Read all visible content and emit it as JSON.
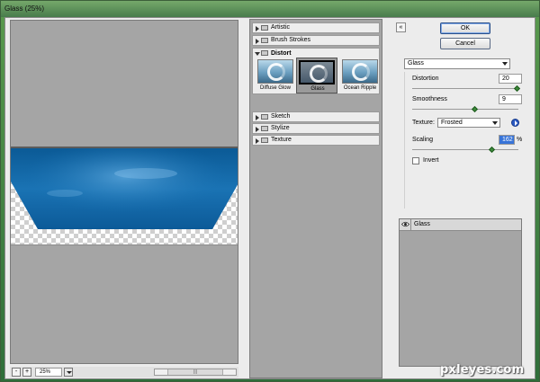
{
  "window": {
    "title": "Glass (25%)"
  },
  "colors": {
    "accent_blue": "#0d5c98",
    "canvas_gray": "#a5a5a5",
    "selected_value": "#3874d8"
  },
  "preview": {
    "zoom_minus": "-",
    "zoom_plus": "+",
    "zoom_value": "25%",
    "scroll_thumb_grip": "|||"
  },
  "gallery": {
    "folders_top": [
      {
        "label": "Artistic"
      },
      {
        "label": "Brush Strokes"
      }
    ],
    "open_folder": {
      "label": "Distort",
      "thumbnails": [
        {
          "label": "Diffuse Glow"
        },
        {
          "label": "Glass",
          "selected": true
        },
        {
          "label": "Ocean Ripple"
        }
      ]
    },
    "folders_bottom": [
      {
        "label": "Sketch"
      },
      {
        "label": "Stylize"
      },
      {
        "label": "Texture"
      }
    ]
  },
  "controls": {
    "collapse_glyph": "«",
    "ok_label": "OK",
    "cancel_label": "Cancel",
    "filter_selected": "Glass",
    "distortion": {
      "label": "Distortion",
      "value": "20",
      "fraction": 1.0
    },
    "smoothness": {
      "label": "Smoothness",
      "value": "9",
      "fraction": 0.6
    },
    "texture": {
      "label": "Texture:",
      "selected": "Frosted"
    },
    "scaling": {
      "label": "Scaling",
      "value": "162",
      "unit": "%",
      "fraction": 0.76
    },
    "invert": {
      "label": "Invert",
      "checked": false
    }
  },
  "layers": {
    "items": [
      {
        "name": "Glass",
        "visible": true
      }
    ]
  },
  "watermark": {
    "text": "pxleyes.com"
  }
}
